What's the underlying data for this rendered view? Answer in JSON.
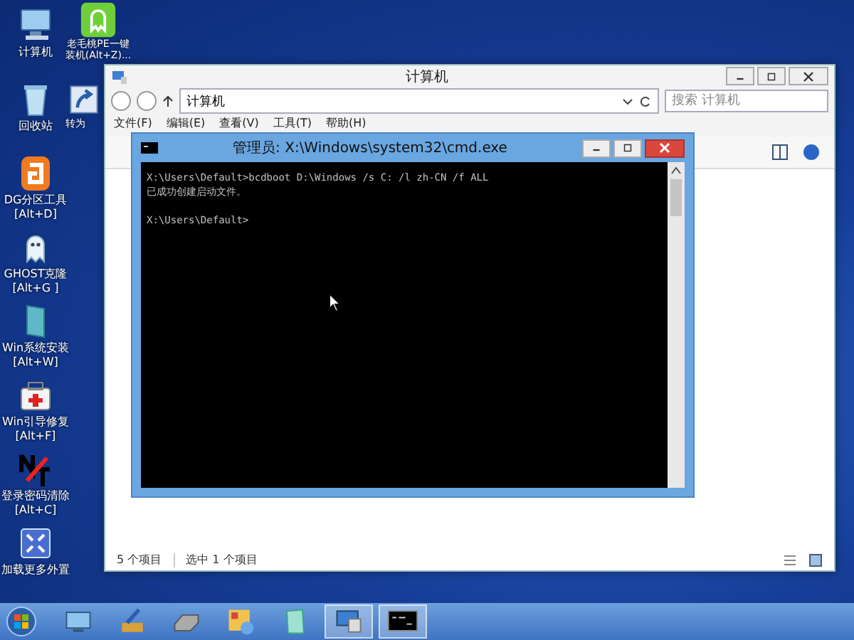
{
  "desktop_icons": [
    {
      "label": "计算机",
      "kind": "computer"
    },
    {
      "label": "回收站",
      "kind": "recycle"
    },
    {
      "label": "DG分区工具\n[Alt+D]",
      "kind": "partition"
    },
    {
      "label": "GHOST克隆\n[Alt+G ]",
      "kind": "ghost"
    },
    {
      "label": "Win系统安装\n[Alt+W]",
      "kind": "install"
    },
    {
      "label": "Win引导修复\n[Alt+F]",
      "kind": "repair"
    },
    {
      "label": "登录密码清除\n[Alt+C]",
      "kind": "password"
    },
    {
      "label": "加载更多外置",
      "kind": "expand"
    }
  ],
  "desktop_icons_column_2": [
    {
      "label": "老毛桃PE一键装机(Alt+Z)...",
      "kind": "app"
    },
    {
      "label": "转为",
      "kind": "shortcut"
    }
  ],
  "explorer": {
    "title": "计算机",
    "address": "计算机",
    "search": {
      "placeholder": "搜索 计算机"
    },
    "menu": [
      "文件(F)",
      "编辑(E)",
      "查看(V)",
      "工具(T)",
      "帮助(H)"
    ],
    "status_bar": [
      "5 个项目",
      "选中 1 个项目"
    ]
  },
  "cmd": {
    "title": "管理员: X:\\Windows\\system32\\cmd.exe",
    "blocks": [
      [
        "X:\\Users\\Default>bcdboot D:\\Windows /s C: /l zh-CN /f ALL",
        "已成功创建启动文件。"
      ],
      [
        "X:\\Users\\Default>"
      ]
    ]
  },
  "taskbar": {
    "items": [
      {
        "kind": "screen",
        "selected": false
      },
      {
        "kind": "brush",
        "selected": false
      },
      {
        "kind": "drive",
        "selected": false
      },
      {
        "kind": "puzzle",
        "selected": false
      },
      {
        "kind": "note",
        "selected": false
      },
      {
        "kind": "computer",
        "selected": true
      },
      {
        "kind": "console",
        "selected": true
      }
    ]
  }
}
